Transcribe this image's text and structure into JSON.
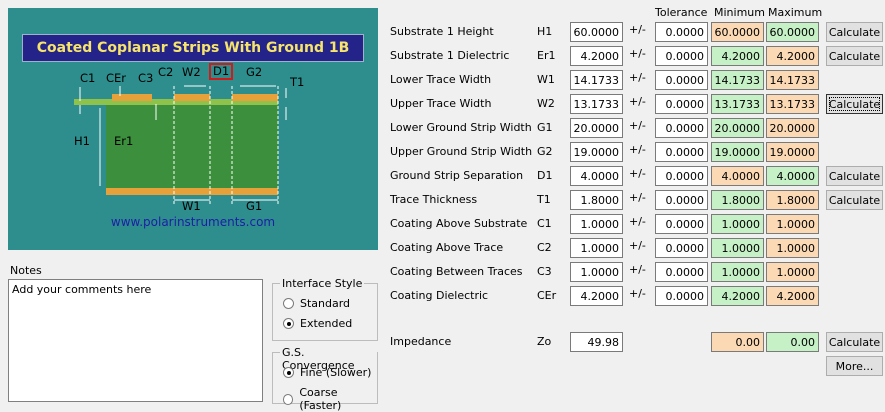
{
  "diagram": {
    "title": "Coated Coplanar Strips With Ground 1B",
    "url": "www.polarinstruments.com",
    "labels": {
      "c1": "C1",
      "cer": "CEr",
      "c3": "C3",
      "c2": "C2",
      "w2": "W2",
      "d1": "D1",
      "g2": "G2",
      "t1": "T1",
      "h1": "H1",
      "er1": "Er1",
      "w1": "W1",
      "g1": "G1"
    }
  },
  "notes": {
    "label": "Notes",
    "text": "Add your comments here"
  },
  "interface_style": {
    "title": "Interface Style",
    "options": [
      {
        "label": "Standard",
        "selected": false
      },
      {
        "label": "Extended",
        "selected": true
      }
    ]
  },
  "convergence": {
    "title": "G.S. Convergence",
    "options": [
      {
        "label": "Fine (Slower)",
        "selected": true
      },
      {
        "label": "Coarse (Faster)",
        "selected": false
      }
    ]
  },
  "headers": {
    "tolerance": "Tolerance",
    "minimum": "Minimum",
    "maximum": "Maximum"
  },
  "pm_symbol": "+/-",
  "params": [
    {
      "label": "Substrate 1 Height",
      "symbol": "H1",
      "value": "60.0000",
      "tol": "0.0000",
      "min": "60.0000",
      "max": "60.0000",
      "min_color": "peach",
      "max_color": "green",
      "button": "Calculate"
    },
    {
      "label": "Substrate 1 Dielectric",
      "symbol": "Er1",
      "value": "4.2000",
      "tol": "0.0000",
      "min": "4.2000",
      "max": "4.2000",
      "min_color": "green",
      "max_color": "peach",
      "button": "Calculate"
    },
    {
      "label": "Lower Trace Width",
      "symbol": "W1",
      "value": "14.1733",
      "tol": "0.0000",
      "min": "14.1733",
      "max": "14.1733",
      "min_color": "green",
      "max_color": "peach",
      "button": ""
    },
    {
      "label": "Upper Trace Width",
      "symbol": "W2",
      "value": "13.1733",
      "tol": "0.0000",
      "min": "13.1733",
      "max": "13.1733",
      "min_color": "green",
      "max_color": "peach",
      "button": "Calculate"
    },
    {
      "label": "Lower Ground Strip Width",
      "symbol": "G1",
      "value": "20.0000",
      "tol": "0.0000",
      "min": "20.0000",
      "max": "20.0000",
      "min_color": "green",
      "max_color": "peach",
      "button": ""
    },
    {
      "label": "Upper Ground Strip Width",
      "symbol": "G2",
      "value": "19.0000",
      "tol": "0.0000",
      "min": "19.0000",
      "max": "19.0000",
      "min_color": "green",
      "max_color": "peach",
      "button": ""
    },
    {
      "label": "Ground Strip Separation",
      "symbol": "D1",
      "value": "4.0000",
      "tol": "0.0000",
      "min": "4.0000",
      "max": "4.0000",
      "min_color": "peach",
      "max_color": "green",
      "button": "Calculate"
    },
    {
      "label": "Trace Thickness",
      "symbol": "T1",
      "value": "1.8000",
      "tol": "0.0000",
      "min": "1.8000",
      "max": "1.8000",
      "min_color": "green",
      "max_color": "peach",
      "button": "Calculate"
    },
    {
      "label": "Coating Above Substrate",
      "symbol": "C1",
      "value": "1.0000",
      "tol": "0.0000",
      "min": "1.0000",
      "max": "1.0000",
      "min_color": "green",
      "max_color": "peach",
      "button": ""
    },
    {
      "label": "Coating Above Trace",
      "symbol": "C2",
      "value": "1.0000",
      "tol": "0.0000",
      "min": "1.0000",
      "max": "1.0000",
      "min_color": "green",
      "max_color": "peach",
      "button": ""
    },
    {
      "label": "Coating Between Traces",
      "symbol": "C3",
      "value": "1.0000",
      "tol": "0.0000",
      "min": "1.0000",
      "max": "1.0000",
      "min_color": "green",
      "max_color": "peach",
      "button": ""
    },
    {
      "label": "Coating Dielectric",
      "symbol": "CEr",
      "value": "4.2000",
      "tol": "0.0000",
      "min": "4.2000",
      "max": "4.2000",
      "min_color": "green",
      "max_color": "peach",
      "button": ""
    }
  ],
  "impedance": {
    "label": "Impedance",
    "symbol": "Zo",
    "value": "49.98",
    "min": "0.00",
    "max": "0.00",
    "min_color": "peach",
    "max_color": "green",
    "calc_button": "Calculate",
    "more_button": "More..."
  },
  "colors": {
    "green": "#c6f0c6",
    "peach": "#fbd9b5",
    "title_text": "#f6e56a",
    "title_bar": "#24238a",
    "url": "#1d1ea6"
  }
}
